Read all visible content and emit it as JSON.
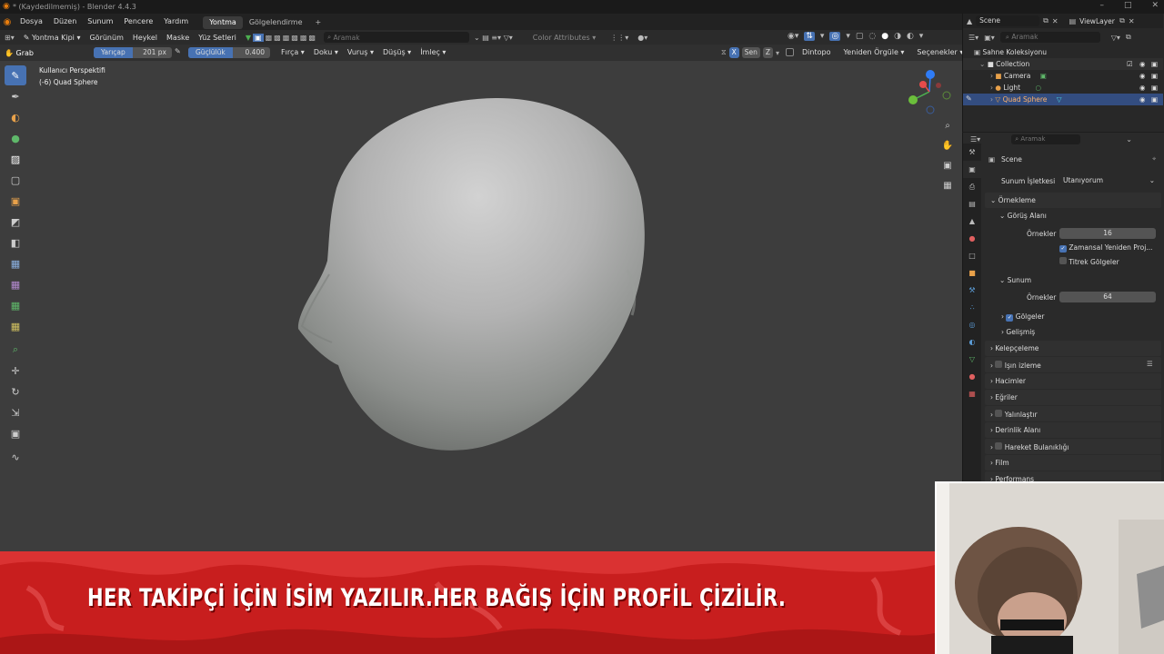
{
  "titlebar": {
    "title": "* (Kaydedilmemiş) - Blender 4.4.3"
  },
  "menu": {
    "items": [
      "Dosya",
      "Düzen",
      "Sunum",
      "Pencere",
      "Yardım"
    ]
  },
  "workspaces": {
    "tabs": [
      "Yontma",
      "Gölgelendirme"
    ],
    "add": "+"
  },
  "header": {
    "mode": "Yontma Kipi",
    "menus": [
      "Görünüm",
      "Heykel",
      "Maske",
      "Yüz Setleri"
    ],
    "search_placeholder": "Aramak",
    "color_attr": "Color Attributes"
  },
  "tool_header": {
    "tool": "Grab",
    "radius_label": "Yarıçap",
    "radius_value": "201 px",
    "strength_label": "Güçlülük",
    "strength_value": "0.400",
    "menus": [
      "Fırça",
      "Doku",
      "Vuruş",
      "Düşüş",
      "İmleç"
    ],
    "sym_x": "X",
    "sym_label": "Sen",
    "sym_z": "Z",
    "dyntopo": "Dintopo",
    "remesh": "Yeniden Örgüle",
    "options": "Seçenekler"
  },
  "viewport": {
    "perspective": "Kullanıcı Perspektifi",
    "object_info": "(-6) Quad Sphere",
    "bg": "#3d3d3d"
  },
  "toolbar": {
    "icons": [
      "grab-brush-icon",
      "draw-brush-icon",
      "clay-brush-icon",
      "paint-brush-icon",
      "mask-brush-icon",
      "box-mask-icon",
      "face-set-icon",
      "trim-icon",
      "line-project-icon",
      "mesh-filter-icon",
      "cloth-filter-icon",
      "color-filter-icon",
      "edit-face-set-icon",
      "mask-by-color-icon",
      "move-icon",
      "rotate-icon",
      "scale-icon",
      "transform-icon",
      "annotate-icon"
    ]
  },
  "outliner": {
    "scene": "Scene",
    "view_layer": "ViewLayer",
    "search_placeholder": "Aramak",
    "root": "Sahne Koleksiyonu",
    "collection": "Collection",
    "objects": [
      "Camera",
      "Light",
      "Quad Sphere"
    ]
  },
  "properties": {
    "search_placeholder": "Aramak",
    "scene": "Scene",
    "render_engine_label": "Sunum İşletkesi",
    "render_engine": "Utanıyorum",
    "sampling": "Örnekleme",
    "viewport": "Görüş Alanı",
    "samples_label": "Örnekler",
    "viewport_samples": "16",
    "temporal": "Zamansal Yeniden Proj...",
    "jitter": "Titrek Gölgeler",
    "render": "Sunum",
    "render_samples": "64",
    "shadows": "Gölgeler",
    "advanced": "Gelişmiş",
    "panels": [
      "Kelepçeleme",
      "Işın izleme",
      "Hacimler",
      "Eğriler",
      "Yalınlaştır",
      "Derinlik Alanı",
      "Hareket Bulanıklığı",
      "Film",
      "Performans"
    ]
  },
  "banner": {
    "text": "HER TAKİPÇİ İÇİN İSİM YAZILIR.HER BAĞIŞ İÇİN PROFİL ÇİZİLİR.",
    "color": "#c81e1e"
  },
  "accent": "#4772b3"
}
